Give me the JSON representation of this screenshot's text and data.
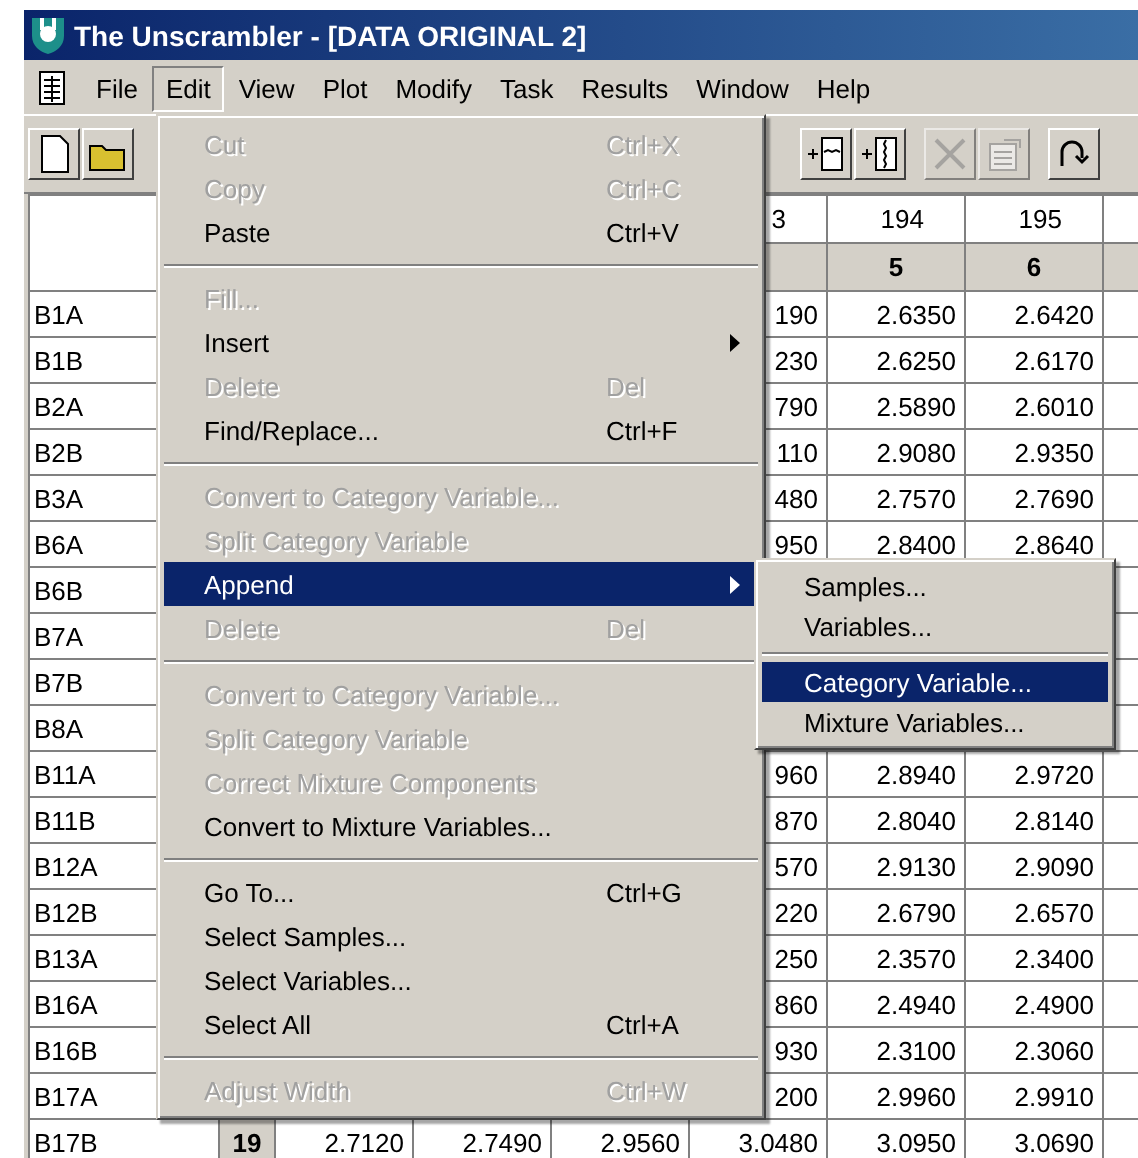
{
  "window": {
    "title": "The Unscrambler - [DATA ORIGINAL 2]"
  },
  "menubar": [
    {
      "label": "File",
      "selected": false
    },
    {
      "label": "Edit",
      "selected": true
    },
    {
      "label": "View",
      "selected": false
    },
    {
      "label": "Plot",
      "selected": false
    },
    {
      "label": "Modify",
      "selected": false
    },
    {
      "label": "Task",
      "selected": false
    },
    {
      "label": "Results",
      "selected": false
    },
    {
      "label": "Window",
      "selected": false
    },
    {
      "label": "Help",
      "selected": false
    }
  ],
  "toolbar": [
    {
      "kind": "new",
      "disabled": false
    },
    {
      "kind": "open",
      "disabled": false
    },
    {
      "kind": "gap"
    },
    {
      "kind": "add-sample",
      "disabled": false
    },
    {
      "kind": "add-variable",
      "disabled": false
    },
    {
      "kind": "delete",
      "disabled": true
    },
    {
      "kind": "properties",
      "disabled": true
    },
    {
      "kind": "undo",
      "disabled": false
    }
  ],
  "grid": {
    "column_headers": [
      "3",
      "194",
      "195"
    ],
    "column_numbers": [
      "5",
      "6"
    ],
    "rows": [
      {
        "label": "B1A",
        "cells": [
          "190",
          "2.6350",
          "2.6420"
        ]
      },
      {
        "label": "B1B",
        "cells": [
          "230",
          "2.6250",
          "2.6170"
        ]
      },
      {
        "label": "B2A",
        "cells": [
          "790",
          "2.5890",
          "2.6010"
        ]
      },
      {
        "label": "B2B",
        "cells": [
          "110",
          "2.9080",
          "2.9350"
        ]
      },
      {
        "label": "B3A",
        "cells": [
          "480",
          "2.7570",
          "2.7690"
        ]
      },
      {
        "label": "B6A",
        "cells": [
          "950",
          "2.8400",
          "2.8640"
        ]
      },
      {
        "label": "B6B"
      },
      {
        "label": "B7A"
      },
      {
        "label": "B7B"
      },
      {
        "label": "B8A"
      },
      {
        "label": "B11A",
        "cells": [
          "960",
          "2.8940",
          "2.9720"
        ]
      },
      {
        "label": "B11B",
        "cells": [
          "870",
          "2.8040",
          "2.8140"
        ]
      },
      {
        "label": "B12A",
        "cells": [
          "570",
          "2.9130",
          "2.9090"
        ]
      },
      {
        "label": "B12B",
        "cells": [
          "220",
          "2.6790",
          "2.6570"
        ]
      },
      {
        "label": "B13A",
        "cells": [
          "250",
          "2.3570",
          "2.3400"
        ]
      },
      {
        "label": "B16A",
        "cells": [
          "860",
          "2.4940",
          "2.4900"
        ]
      },
      {
        "label": "B16B",
        "cells": [
          "930",
          "2.3100",
          "2.3060"
        ]
      },
      {
        "label": "B17A",
        "cells": [
          "200",
          "2.9960",
          "2.9910"
        ]
      },
      {
        "label": "B17B",
        "index": "19",
        "cells": [
          "2.7120",
          "2.7490",
          "2.9560",
          "3.0480",
          "3.0950",
          "3.0690"
        ]
      }
    ]
  },
  "edit_menu": {
    "items": [
      {
        "kind": "item",
        "label": "Cut",
        "shortcut": "Ctrl+X",
        "disabled": true,
        "selected": false
      },
      {
        "kind": "item",
        "label": "Copy",
        "shortcut": "Ctrl+C",
        "disabled": true,
        "selected": false
      },
      {
        "kind": "item",
        "label": "Paste",
        "shortcut": "Ctrl+V",
        "disabled": false,
        "selected": false
      },
      {
        "kind": "separator"
      },
      {
        "kind": "item",
        "label": "Fill...",
        "disabled": true,
        "selected": false
      },
      {
        "kind": "submenu",
        "label": "Insert",
        "disabled": false,
        "selected": false
      },
      {
        "kind": "item",
        "label": "Delete",
        "shortcut": "Del",
        "disabled": true,
        "selected": false
      },
      {
        "kind": "item",
        "label": "Find/Replace...",
        "shortcut": "Ctrl+F",
        "disabled": false,
        "selected": false
      },
      {
        "kind": "separator"
      },
      {
        "kind": "item",
        "label": "Convert to Category Variable...",
        "disabled": true,
        "selected": false
      },
      {
        "kind": "item",
        "label": "Split Category Variable",
        "disabled": true,
        "selected": false
      },
      {
        "kind": "submenu",
        "label": "Append",
        "disabled": false,
        "selected": true
      },
      {
        "kind": "item",
        "label": "Delete",
        "shortcut": "Del",
        "disabled": true,
        "selected": false
      },
      {
        "kind": "separator"
      },
      {
        "kind": "item",
        "label": "Convert to Category Variable...",
        "disabled": true,
        "selected": false
      },
      {
        "kind": "item",
        "label": "Split Category Variable",
        "disabled": true,
        "selected": false
      },
      {
        "kind": "item",
        "label": "Correct Mixture Components",
        "disabled": true,
        "selected": false
      },
      {
        "kind": "item",
        "label": "Convert to Mixture Variables...",
        "disabled": false,
        "selected": false
      },
      {
        "kind": "separator"
      },
      {
        "kind": "item",
        "label": "Go To...",
        "shortcut": "Ctrl+G",
        "disabled": false,
        "selected": false
      },
      {
        "kind": "item",
        "label": "Select Samples...",
        "disabled": false,
        "selected": false
      },
      {
        "kind": "item",
        "label": "Select Variables...",
        "disabled": false,
        "selected": false
      },
      {
        "kind": "item",
        "label": "Select All",
        "shortcut": "Ctrl+A",
        "disabled": false,
        "selected": false
      },
      {
        "kind": "separator"
      },
      {
        "kind": "item",
        "label": "Adjust Width",
        "shortcut": "Ctrl+W",
        "disabled": true,
        "selected": false
      }
    ]
  },
  "append_submenu": {
    "items": [
      {
        "kind": "item",
        "label": "Samples...",
        "disabled": false,
        "selected": false
      },
      {
        "kind": "item",
        "label": "Variables...",
        "disabled": false,
        "selected": false
      },
      {
        "kind": "separator"
      },
      {
        "kind": "item",
        "label": "Category Variable...",
        "disabled": false,
        "selected": true
      },
      {
        "kind": "item",
        "label": "Mixture Variables...",
        "disabled": false,
        "selected": false
      }
    ]
  }
}
